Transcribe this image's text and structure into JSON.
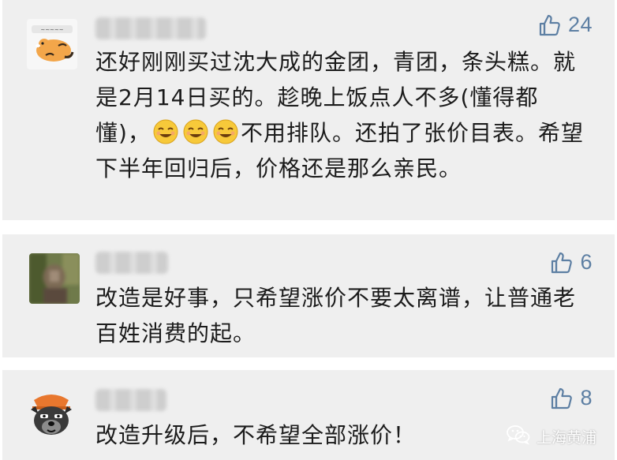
{
  "comments": [
    {
      "avatar": "tiger-cartoon-avatar",
      "likes": "24",
      "text_parts": [
        "还好刚刚买过沈大成的金团，青团，条头糕。就是2月14日买的。趁晚上饭点人不多(懂得都懂)，",
        "不用排队。还拍了张价目表。希望下半年回归后，价格还是那么亲民。"
      ],
      "emoji_count": 3
    },
    {
      "avatar": "blurred-photo-avatar",
      "likes": "6",
      "text": "改造是好事，只希望涨价不要太离谱，让普通老百姓消费的起。"
    },
    {
      "avatar": "cartoon-dog-avatar",
      "likes": "8",
      "text": "改造升级后，不希望全部涨价！"
    }
  ],
  "watermark": {
    "icon": "wechat-icon",
    "text": "上海黄浦"
  },
  "colors": {
    "card_bg": "#efefef",
    "like_blue": "#5d7fa3",
    "text": "#1b1b1b"
  }
}
